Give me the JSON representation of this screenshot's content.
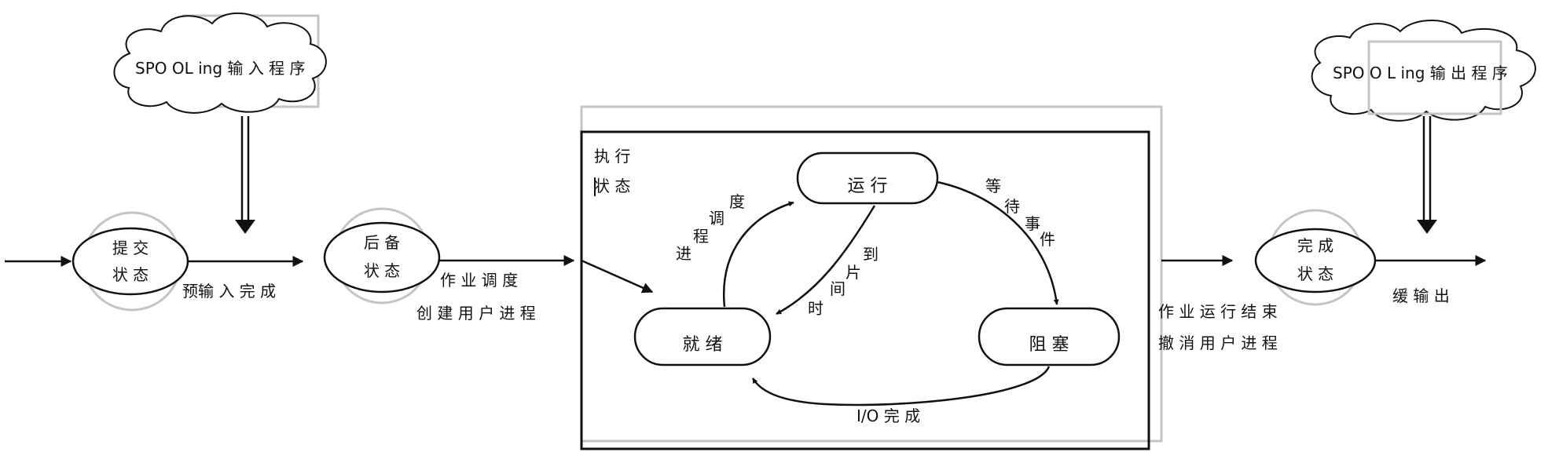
{
  "spool_in": "SPO OL ing 输 入 程 序",
  "spool_out": "SPO O L ing 输 出 程 序",
  "states": {
    "submit": [
      "提 交",
      "状 态"
    ],
    "backup": [
      "后 备",
      "状 态"
    ],
    "done": [
      "完 成",
      "状 态"
    ]
  },
  "edges": {
    "pre_input": "预输 入 完 成",
    "job_sched": [
      "作 业 调 度",
      "创 建 用 户 进 程"
    ],
    "job_end": [
      "作 业 运 行 结 束",
      "撤 消 用 户 进 程"
    ],
    "buffer_out": "缓 输 出"
  },
  "exec": {
    "title": [
      "执 行",
      "状 态"
    ],
    "running": "运 行",
    "ready": "就 绪",
    "blocked": "阻 塞",
    "proc_sched": [
      "进",
      "程",
      "调",
      "度"
    ],
    "wait_event": [
      "等",
      "待",
      "事",
      "件"
    ],
    "time_slice": [
      "时",
      "间",
      "片",
      "到"
    ],
    "io_done": "I/O 完 成"
  }
}
